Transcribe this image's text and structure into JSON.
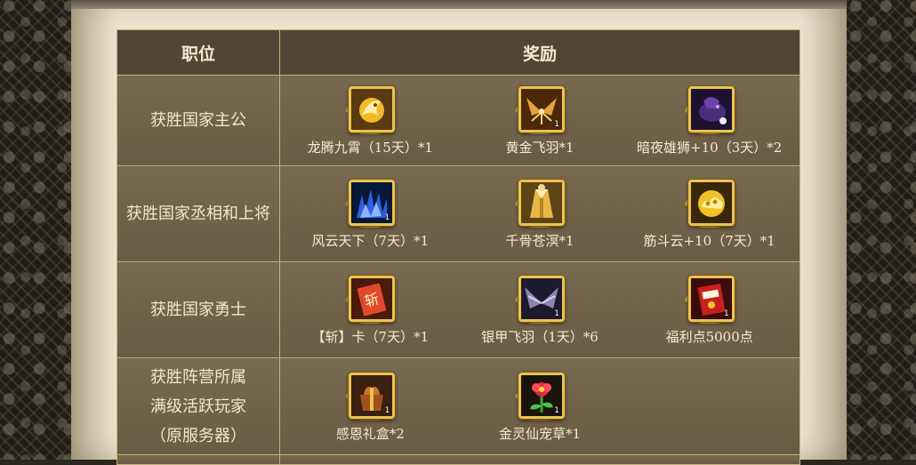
{
  "table": {
    "header": {
      "position": "职位",
      "reward": "奖励"
    },
    "rows": [
      {
        "position_lines": [
          "获胜国家主公"
        ],
        "items": [
          {
            "name": "龙腾九霄（15天）*1",
            "icon": "golden-dragon-icon",
            "qty": ""
          },
          {
            "name": "黄金飞羽*1",
            "icon": "golden-feather-wings-icon",
            "qty": "1"
          },
          {
            "name": "暗夜雄狮+10（3天）*2",
            "icon": "dark-lion-mount-icon",
            "qty": ""
          }
        ]
      },
      {
        "position_lines": [
          "获胜国家丞相和上将"
        ],
        "items": [
          {
            "name": "风云天下（7天）*1",
            "icon": "blue-storm-aura-icon",
            "qty": "1"
          },
          {
            "name": "千骨苍溟*1",
            "icon": "golden-robe-costume-icon",
            "qty": ""
          },
          {
            "name": "筋斗云+10（7天）*1",
            "icon": "golden-cloud-mount-icon",
            "qty": ""
          }
        ]
      },
      {
        "position_lines": [
          "获胜国家勇士"
        ],
        "items": [
          {
            "name": "【斩】卡（7天）*1",
            "icon": "slash-card-icon",
            "qty": ""
          },
          {
            "name": "银甲飞羽（1天）*6",
            "icon": "silver-wings-icon",
            "qty": "1"
          },
          {
            "name": "福利点5000点",
            "icon": "welfare-points-envelope-icon",
            "qty": "1"
          }
        ]
      },
      {
        "position_lines": [
          "获胜阵营所属",
          "满级活跃玩家",
          "（原服务器）"
        ],
        "items": [
          {
            "name": "感恩礼盒*2",
            "icon": "gift-box-icon",
            "qty": "1"
          },
          {
            "name": "金灵仙宠草*1",
            "icon": "red-flower-herb-icon",
            "qty": "1"
          }
        ]
      }
    ]
  },
  "colors": {
    "header_bg": "#524534",
    "cell_bg": "#6b5d45",
    "border": "#c9b27a",
    "text": "#f4e7c5",
    "icon_frame": "#e9c452"
  }
}
